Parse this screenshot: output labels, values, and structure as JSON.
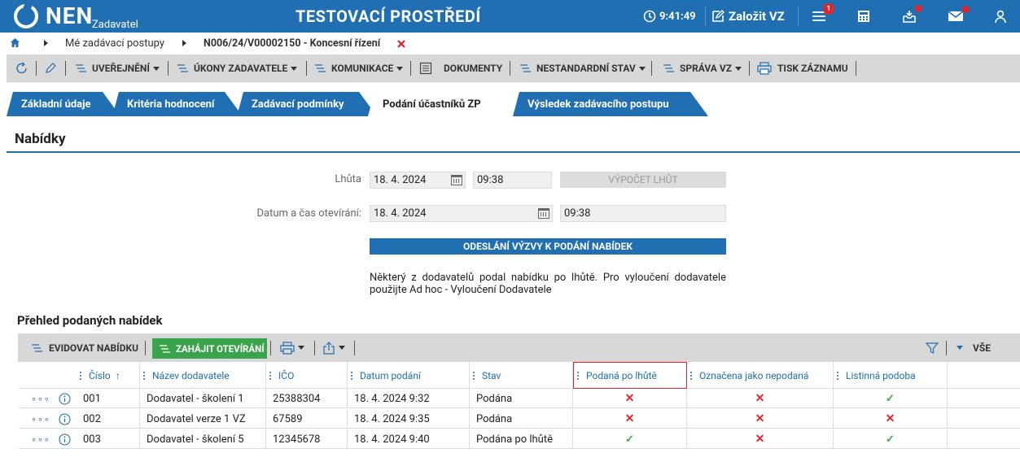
{
  "app": {
    "logo": "NEN",
    "logo_sub": "Zadavatel",
    "environment": "TESTOVACÍ PROSTŘEDÍ",
    "time": "9:41:49",
    "create_label": "Založit VZ",
    "notification_count": "1"
  },
  "breadcrumb": {
    "items": [
      "Mé zadávací postupy",
      "N006/24/V00002150 - Koncesní řízení"
    ]
  },
  "toolbar": {
    "items": [
      "UVEŘEJNĚNÍ",
      "ÚKONY ZADAVATELE",
      "KOMUNIKACE",
      "DOKUMENTY",
      "NESTANDARDNÍ STAV",
      "SPRÁVA VZ",
      "TISK ZÁZNAMU"
    ]
  },
  "tabs": [
    "Základní údaje",
    "Kritéria hodnocení",
    "Zadávací podmínky",
    "Podání účastníků ZP",
    "Výsledek zadávacího postupu"
  ],
  "section": {
    "title": "Nabídky"
  },
  "form": {
    "deadline_label": "Lhůta",
    "deadline_date": "18. 4. 2024",
    "deadline_time": "09:38",
    "calc_button": "VÝPOČET LHŮT",
    "opening_label": "Datum a čas otevírání:",
    "opening_date": "18. 4. 2024",
    "opening_time": "09:38",
    "send_button": "ODESLÁNÍ VÝZVY K PODÁNÍ NABÍDEK",
    "note": "Některý z dodavatelů podal nabídku po lhůtě. Pro vyloučení dodavatele použijte Ad hoc - Vyloučení Dodavatele"
  },
  "offers": {
    "title": "Přehled podaných nabídek",
    "register_button": "EVIDOVAT NABÍDKU",
    "start_button": "ZAHÁJIT OTEVÍRÁNÍ",
    "filter_all": "VŠE",
    "columns": [
      "Číslo",
      "Název dodavatele",
      "IČO",
      "Datum podání",
      "Stav",
      "Podaná po lhůtě",
      "Označena jako nepodaná",
      "Listinná podoba"
    ],
    "sort_indicator": "↑",
    "rows": [
      {
        "number": "001",
        "supplier": "Dodavatel - školení 1",
        "ico": "25388304",
        "date": "18. 4. 2024 9:32",
        "state": "Podána",
        "late": false,
        "unsubmitted": false,
        "paper": true
      },
      {
        "number": "002",
        "supplier": "Dodavatel verze 1 VZ",
        "ico": "67589",
        "date": "18. 4. 2024 9:35",
        "state": "Podána",
        "late": false,
        "unsubmitted": false,
        "paper": false
      },
      {
        "number": "003",
        "supplier": "Dodavatel - školení 5",
        "ico": "12345678",
        "date": "18. 4. 2024 9:40",
        "state": "Podána po lhůtě",
        "late": true,
        "unsubmitted": false,
        "paper": true
      }
    ]
  },
  "colors": {
    "primary": "#1f6fb2",
    "green": "#3aa44a",
    "red": "#e0242c",
    "toolbar": "#d8d8d8"
  }
}
